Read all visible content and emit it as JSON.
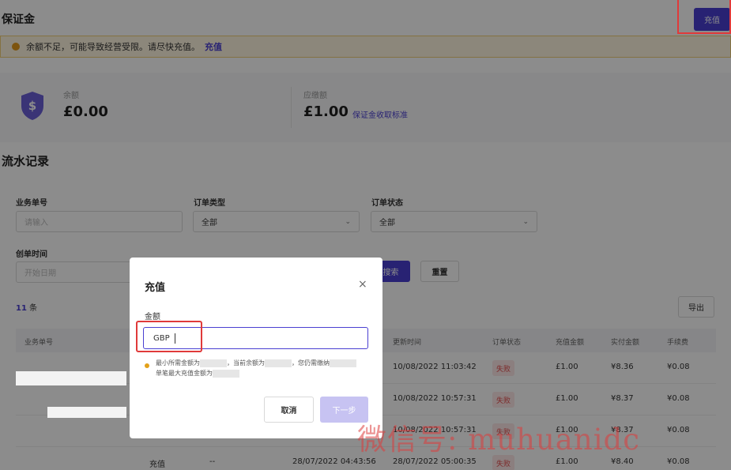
{
  "header": {
    "title": "保证金",
    "recharge_label": "充值"
  },
  "alert": {
    "text": "余额不足，可能导致经营受限。请尽快充值。",
    "link": "充值"
  },
  "balance": {
    "balance_label": "余额",
    "balance_value": "£0.00",
    "due_label": "应缴额",
    "due_value": "£1.00",
    "due_link": "保证金收取标准"
  },
  "records": {
    "title": "流水记录",
    "filters": {
      "order_no_label": "业务单号",
      "order_no_placeholder": "请输入",
      "order_type_label": "订单类型",
      "order_type_value": "全部",
      "order_status_label": "订单状态",
      "order_status_value": "全部",
      "created_label": "创单时间",
      "created_placeholder": "开始日期"
    },
    "search_label": "搜索",
    "reset_label": "重置",
    "count_num": "11",
    "count_unit": "条",
    "export_label": "导出",
    "columns": [
      "业务单号",
      "更新时间",
      "订单状态",
      "充值金额",
      "实付金额",
      "手续费"
    ],
    "rows": [
      {
        "updated": "10/08/2022 11:03:42",
        "status": "失败",
        "amount": "£1.00",
        "paid": "¥8.36",
        "fee": "¥0.08"
      },
      {
        "updated": "10/08/2022 10:57:31",
        "status": "失败",
        "amount": "£1.00",
        "paid": "¥8.37",
        "fee": "¥0.08"
      },
      {
        "updated": "10/08/2022 10:57:31",
        "status": "失败",
        "amount": "£1.00",
        "paid": "¥8.37",
        "fee": "¥0.08"
      },
      {
        "type": "充值",
        "dash": "--",
        "created": "28/07/2022 04:43:56",
        "updated": "28/07/2022 05:00:35",
        "status": "失败",
        "amount": "£1.00",
        "paid": "¥8.40",
        "fee": "¥0.08"
      }
    ]
  },
  "modal": {
    "title": "充值",
    "close": "×",
    "amount_label": "金额",
    "currency": "GBP",
    "tip_line1_a": "最小所需金额为",
    "tip_line1_b": "，当前余额为",
    "tip_line1_c": "，您仍需缴纳",
    "tip_line2": "单笔最大充值金额为",
    "cancel_label": "取消",
    "next_label": "下一步"
  },
  "watermark": "微信号: muhuanidc",
  "colors": {
    "accent": "#4a3fd1",
    "danger": "#e24a4a",
    "warning": "#e39a1a"
  }
}
